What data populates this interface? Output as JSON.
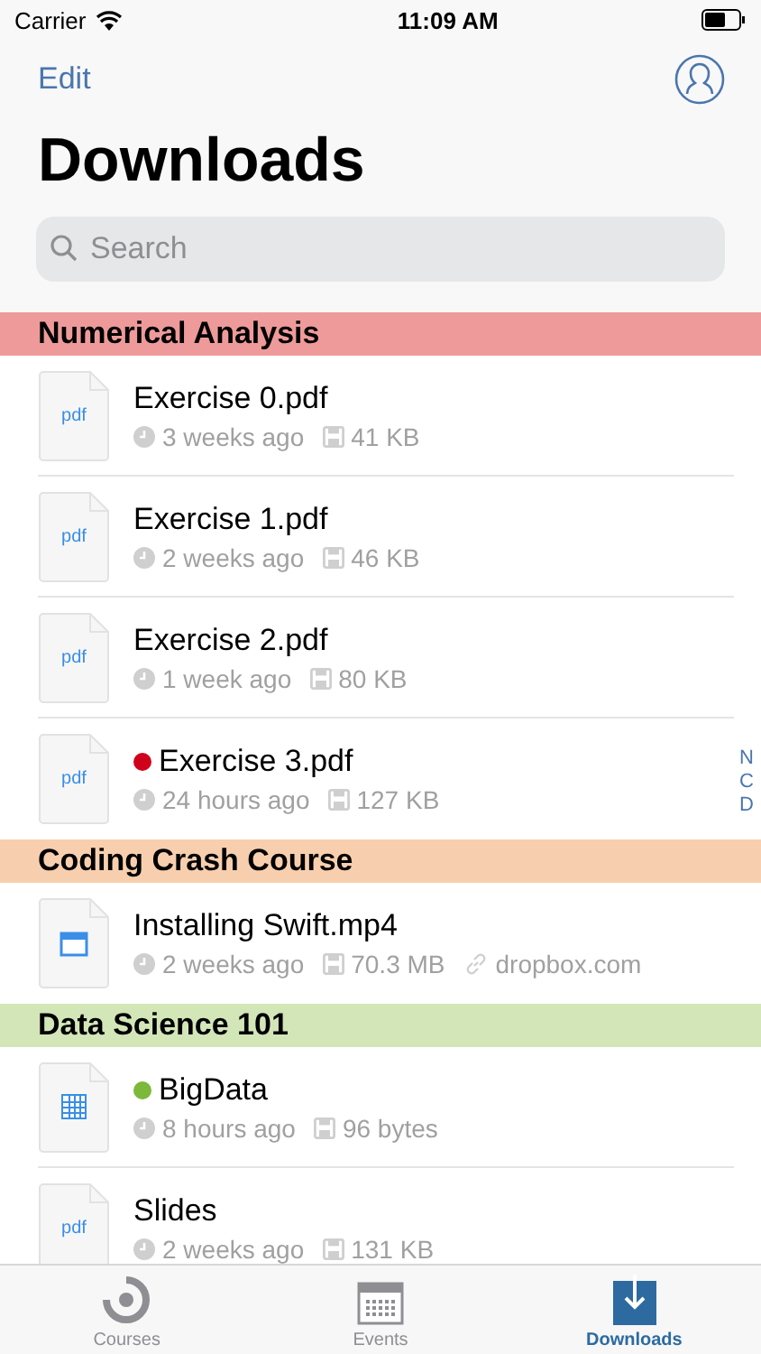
{
  "status_bar": {
    "carrier": "Carrier",
    "time": "11:09 AM"
  },
  "nav": {
    "edit": "Edit",
    "title": "Downloads"
  },
  "search": {
    "placeholder": "Search"
  },
  "sections": [
    {
      "title": "Numerical Analysis",
      "color": "#ee9a9a",
      "items": [
        {
          "kind": "pdf",
          "icon_label": "pdf",
          "name": "Exercise 0.pdf",
          "time": "3 weeks ago",
          "size": "41 KB"
        },
        {
          "kind": "pdf",
          "icon_label": "pdf",
          "name": "Exercise 1.pdf",
          "time": "2 weeks ago",
          "size": "46 KB"
        },
        {
          "kind": "pdf",
          "icon_label": "pdf",
          "name": "Exercise 2.pdf",
          "time": "1 week ago",
          "size": "80 KB"
        },
        {
          "kind": "pdf",
          "icon_label": "pdf",
          "name": "Exercise 3.pdf",
          "time": "24 hours ago",
          "size": "127 KB",
          "color": "#d0021b"
        }
      ]
    },
    {
      "title": "Coding Crash Course",
      "color": "#f8cfae",
      "items": [
        {
          "kind": "video",
          "name": "Installing Swift.mp4",
          "time": "2 weeks ago",
          "size": "70.3 MB",
          "source": "dropbox.com"
        }
      ]
    },
    {
      "title": "Data Science 101",
      "color": "#d3e6b8",
      "items": [
        {
          "kind": "table",
          "name": "BigData",
          "time": "8 hours ago",
          "size": "96 bytes",
          "color": "#7cb83a"
        },
        {
          "kind": "pdf",
          "icon_label": "pdf",
          "name": "Slides",
          "time": "2 weeks ago",
          "size": "131 KB"
        }
      ]
    }
  ],
  "index": [
    "N",
    "C",
    "D"
  ],
  "tabs": [
    {
      "label": "Courses",
      "kind": "courses",
      "selected": false
    },
    {
      "label": "Events",
      "kind": "events",
      "selected": false
    },
    {
      "label": "Downloads",
      "kind": "downloads",
      "selected": true
    }
  ]
}
